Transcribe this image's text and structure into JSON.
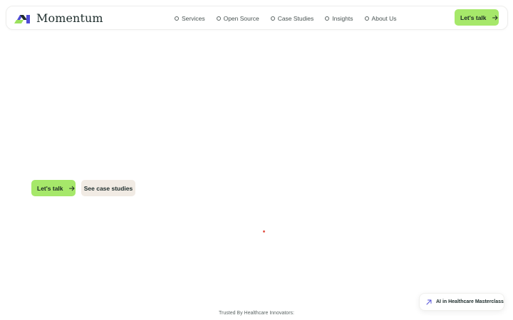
{
  "header": {
    "brand_name": "Momentum",
    "nav": [
      {
        "label": "Services"
      },
      {
        "label": "Open Source"
      },
      {
        "label": "Case Studies"
      },
      {
        "label": "Insights"
      },
      {
        "label": "About Us"
      }
    ],
    "cta_label": "Let's talk"
  },
  "hero": {
    "primary_cta_label": "Let's talk",
    "secondary_cta_label": "See case studies"
  },
  "promo": {
    "label": "AI in Healthcare Masterclass",
    "icon": "arrow-up-right-icon"
  },
  "footer": {
    "trusted_label": "Trusted By Healthcare Innovators:"
  },
  "colors": {
    "accent_green": "#a6e86a",
    "secondary_beige": "#f1ebe4",
    "logo_purple": "#4f4bd6",
    "logo_green": "#9be15d",
    "logo_dark": "#1f2b2a",
    "indicator_red": "#e2574c"
  }
}
